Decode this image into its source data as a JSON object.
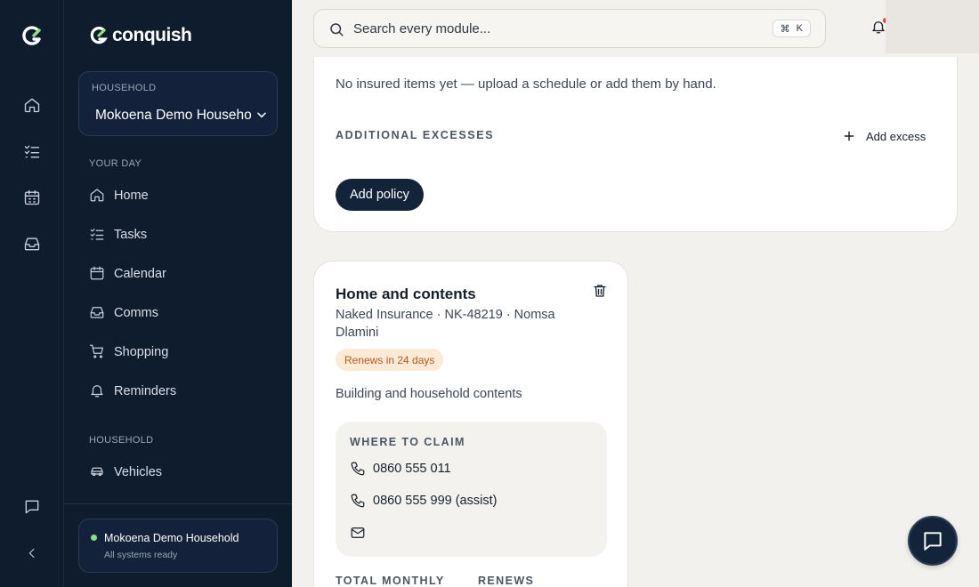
{
  "brand": {
    "name": "conquish"
  },
  "household_select": {
    "label": "HOUSEHOLD",
    "value": "Mokoena Demo Household"
  },
  "nav": {
    "your_day_label": "YOUR DAY",
    "your_day": [
      {
        "label": "Home",
        "icon": "home-icon"
      },
      {
        "label": "Tasks",
        "icon": "tasks-icon"
      },
      {
        "label": "Calendar",
        "icon": "calendar-icon"
      },
      {
        "label": "Comms",
        "icon": "inbox-icon"
      },
      {
        "label": "Shopping",
        "icon": "cart-icon"
      },
      {
        "label": "Reminders",
        "icon": "bell-icon"
      }
    ],
    "household_label": "HOUSEHOLD",
    "household": [
      {
        "label": "Vehicles",
        "icon": "car-icon"
      }
    ]
  },
  "status": {
    "name": "Mokoena Demo Household",
    "subtitle": "All systems ready",
    "color": "#8ee07a"
  },
  "search": {
    "placeholder": "Search every module...",
    "shortcut_mod": "⌘",
    "shortcut_key": "K"
  },
  "insured_items": {
    "empty_text": "No insured items yet — upload a schedule or add them by hand."
  },
  "excesses": {
    "label": "ADDITIONAL EXCESSES",
    "add_label": "Add excess"
  },
  "add_policy_label": "Add policy",
  "policy": {
    "title": "Home and contents",
    "meta": "Naked Insurance · NK-48219 · Nomsa Dlamini",
    "badge": "Renews in 24 days",
    "description": "Building and household contents",
    "claim": {
      "label": "WHERE TO CLAIM",
      "phone_primary": "0860 555 011",
      "phone_assist": "0860 555 999 (assist)"
    },
    "total_monthly_label": "TOTAL MONTHLY",
    "renews_label": "RENEWS"
  },
  "colors": {
    "sidebar_bg": "#0f1c2e",
    "accent_dark": "#13243a",
    "badge_bg": "#fbead6",
    "badge_text": "#b8591c",
    "page_bg": "#f3f1ed"
  }
}
